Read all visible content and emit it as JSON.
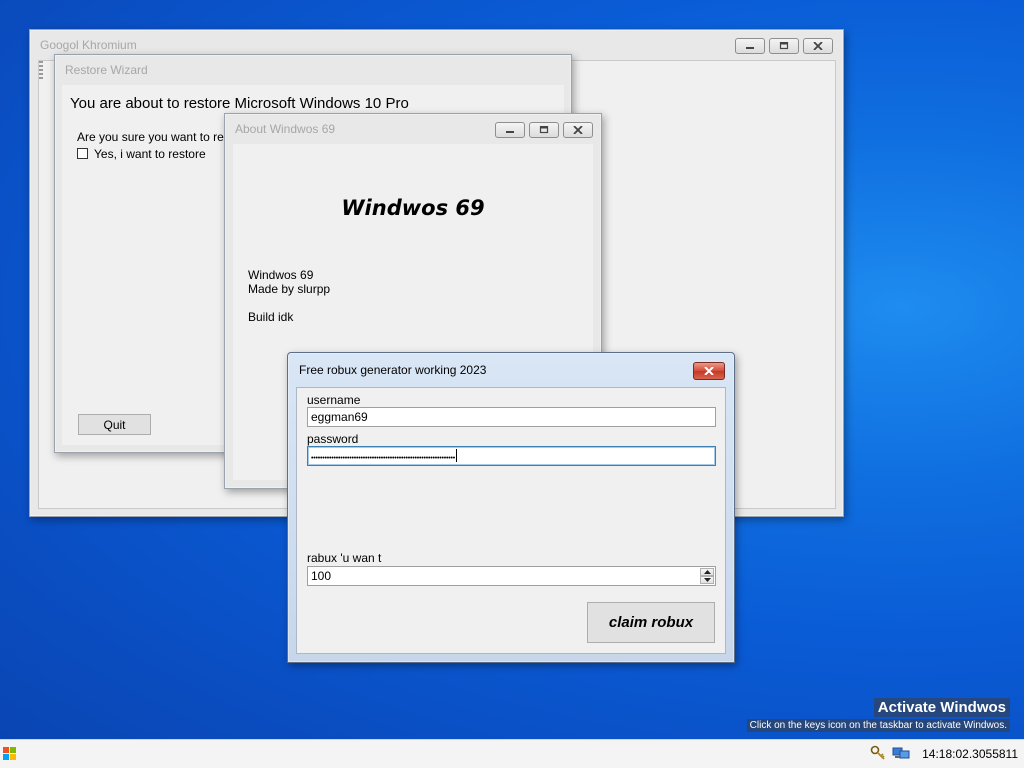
{
  "windows": {
    "chrome": {
      "title": "Googol Khromium"
    },
    "restore": {
      "title": "Restore Wizard",
      "heading": "You are about to restore Microsoft Windows 10 Pro",
      "question": "Are you sure you want to restore",
      "checkbox_label": "Yes, i want to restore",
      "checkbox_checked": false,
      "quit_label": "Quit"
    },
    "about": {
      "title": "About Windwos 69",
      "big_title": "Windwos 69",
      "line1": "Windwos 69",
      "line2": "Made by slurpp",
      "line3": "Build idk"
    },
    "robux": {
      "title": "Free robux generator working 2023",
      "username_label": "username",
      "username_value": "eggman69",
      "password_label": "password",
      "password_value": "••••••••••••••••••••••••••••••••••••••••••••••••••••••••••••••••",
      "amount_label": "rabux 'u wan t",
      "amount_value": "100",
      "claim_label": "claim robux"
    }
  },
  "watermark": {
    "title": "Activate Windwos",
    "subtitle": "Click on the keys icon on the taskbar to activate Windwos."
  },
  "taskbar": {
    "clock": "14:18:02.3055811",
    "tray_icons": [
      "keys-icon",
      "network-icon"
    ]
  },
  "colors": {
    "desktop": "#0a5cd6",
    "close_button": "#d34a36"
  }
}
